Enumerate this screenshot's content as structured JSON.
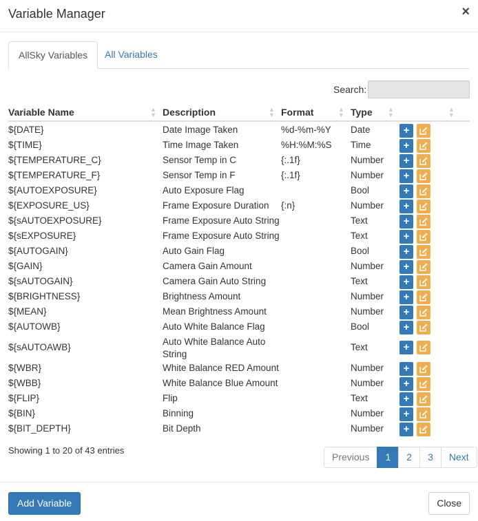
{
  "modal": {
    "title": "Variable Manager",
    "close_glyph": "×"
  },
  "tabs": [
    {
      "label": "AllSky Variables",
      "active": true
    },
    {
      "label": "All Variables",
      "active": false
    }
  ],
  "search": {
    "label": "Search:",
    "value": ""
  },
  "table": {
    "headers": [
      "Variable Name",
      "Description",
      "Format",
      "Type",
      ""
    ],
    "rows": [
      {
        "name": "${DATE}",
        "description": "Date Image Taken",
        "format": "%d-%m-%Y",
        "type": "Date"
      },
      {
        "name": "${TIME}",
        "description": "Time Image Taken",
        "format": "%H:%M:%S",
        "type": "Time"
      },
      {
        "name": "${TEMPERATURE_C}",
        "description": "Sensor Temp in C",
        "format": "{:.1f}",
        "type": "Number"
      },
      {
        "name": "${TEMPERATURE_F}",
        "description": "Sensor Temp in F",
        "format": "{:.1f}",
        "type": "Number"
      },
      {
        "name": "${AUTOEXPOSURE}",
        "description": "Auto Exposure Flag",
        "format": "",
        "type": "Bool"
      },
      {
        "name": "${EXPOSURE_US}",
        "description": "Frame Exposure Duration",
        "format": "{:n}",
        "type": "Number"
      },
      {
        "name": "${sAUTOEXPOSURE}",
        "description": "Frame Exposure Auto String",
        "format": "",
        "type": "Text"
      },
      {
        "name": "${sEXPOSURE}",
        "description": "Frame Exposure Auto String",
        "format": "",
        "type": "Text"
      },
      {
        "name": "${AUTOGAIN}",
        "description": "Auto Gain Flag",
        "format": "",
        "type": "Bool"
      },
      {
        "name": "${GAIN}",
        "description": "Camera Gain Amount",
        "format": "",
        "type": "Number"
      },
      {
        "name": "${sAUTOGAIN}",
        "description": "Camera Gain Auto String",
        "format": "",
        "type": "Text"
      },
      {
        "name": "${BRIGHTNESS}",
        "description": "Brightness Amount",
        "format": "",
        "type": "Number"
      },
      {
        "name": "${MEAN}",
        "description": "Mean Brightness Amount",
        "format": "",
        "type": "Number"
      },
      {
        "name": "${AUTOWB}",
        "description": "Auto White Balance Flag",
        "format": "",
        "type": "Bool"
      },
      {
        "name": "${sAUTOAWB}",
        "description": "Auto White Balance Auto String",
        "format": "",
        "type": "Text",
        "tall": true
      },
      {
        "name": "${WBR}",
        "description": "White Balance RED Amount",
        "format": "",
        "type": "Number"
      },
      {
        "name": "${WBB}",
        "description": "White Balance Blue Amount",
        "format": "",
        "type": "Number"
      },
      {
        "name": "${FLIP}",
        "description": "Flip",
        "format": "",
        "type": "Text"
      },
      {
        "name": "${BIN}",
        "description": "Binning",
        "format": "",
        "type": "Number"
      },
      {
        "name": "${BIT_DEPTH}",
        "description": "Bit Depth",
        "format": "",
        "type": "Number"
      }
    ],
    "row_actions": {
      "add_glyph": "+",
      "edit_icon": "edit-icon"
    }
  },
  "info": "Showing 1 to 20 of 43 entries",
  "pagination": {
    "previous": "Previous",
    "pages": [
      "1",
      "2",
      "3"
    ],
    "current": "1",
    "next": "Next"
  },
  "footer": {
    "add_label": "Add Variable",
    "close_label": "Close"
  },
  "colors": {
    "primary": "#337ab7",
    "warning": "#f0ad4e",
    "border": "#dddddd"
  }
}
